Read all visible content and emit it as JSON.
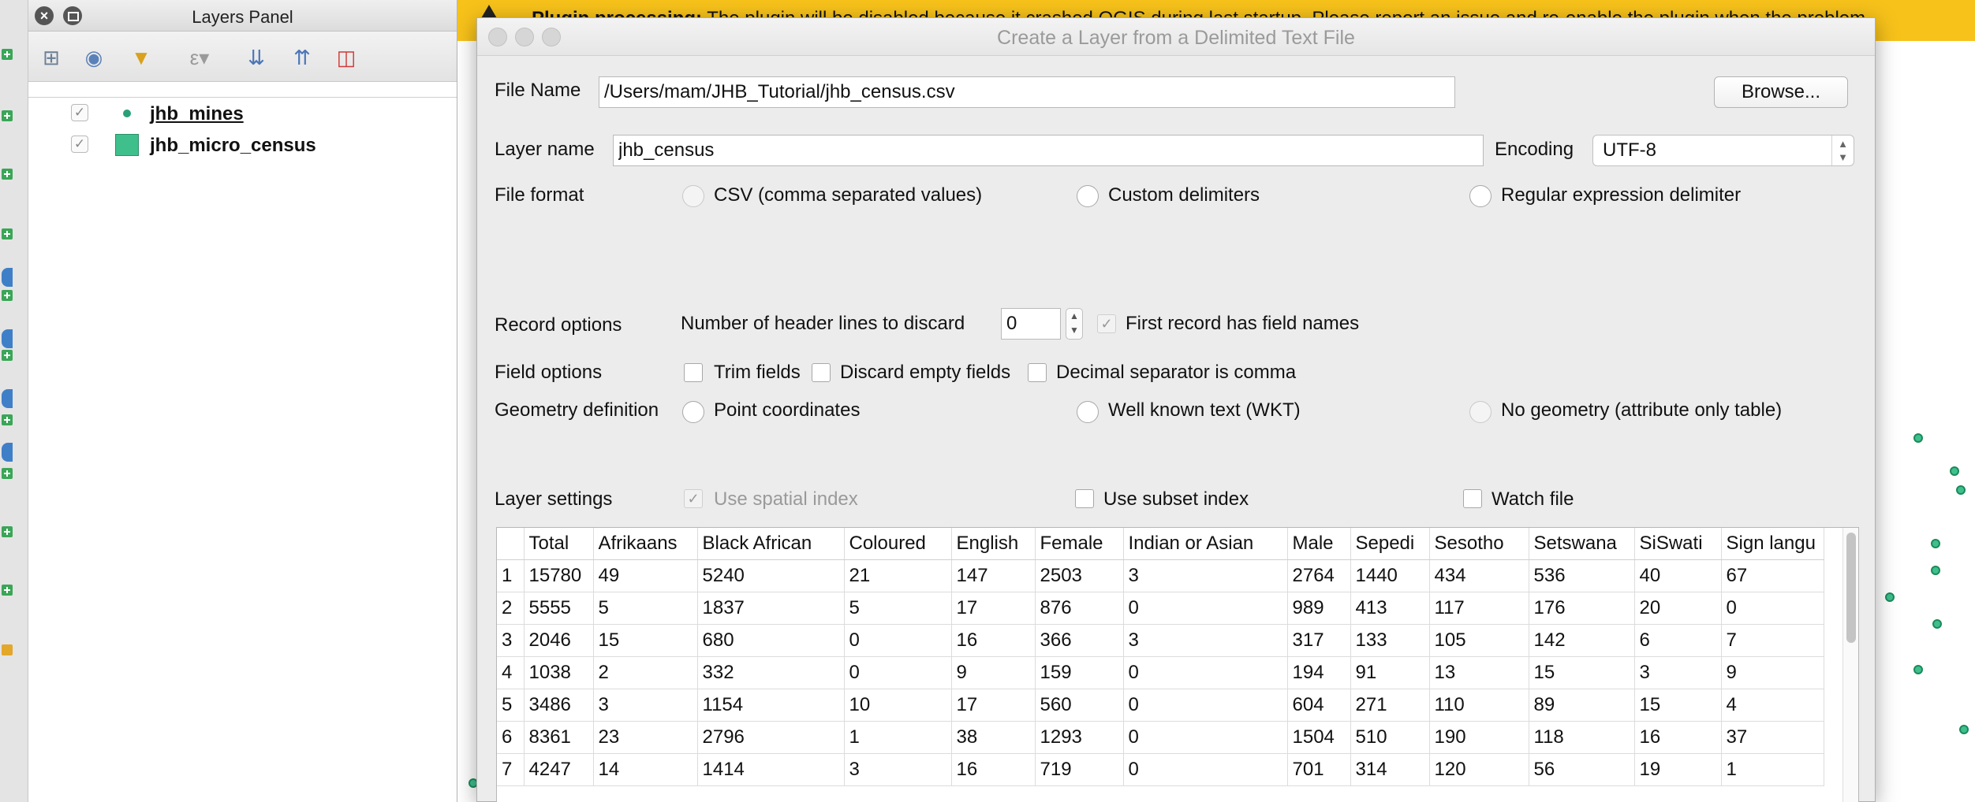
{
  "layers_panel": {
    "title": "Layers Panel",
    "layers": [
      {
        "name": "jhb_mines",
        "checked": true,
        "symbol": "point"
      },
      {
        "name": "jhb_micro_census",
        "checked": true,
        "symbol": "polygon"
      }
    ]
  },
  "banner": {
    "bold": "Plugin processing:",
    "text": " The plugin will be disabled because it crashed QGIS during last startup. Please report an issue and re-enable the plugin when the problem"
  },
  "dialog": {
    "title": "Create a Layer from a Delimited Text File",
    "file_name_label": "File Name",
    "file_name_value": "/Users/mam/JHB_Tutorial/jhb_census.csv",
    "browse_label": "Browse...",
    "layer_name_label": "Layer name",
    "layer_name_value": "jhb_census",
    "encoding_label": "Encoding",
    "encoding_value": "UTF-8",
    "file_format_label": "File format",
    "file_format_options": [
      "CSV (comma separated values)",
      "Custom delimiters",
      "Regular expression delimiter"
    ],
    "record_options_label": "Record options",
    "header_lines_label": "Number of header lines to discard",
    "header_lines_value": "0",
    "first_record_label": "First record has field names",
    "field_options_label": "Field options",
    "trim_fields_label": "Trim fields",
    "discard_empty_label": "Discard empty fields",
    "decimal_comma_label": "Decimal separator is comma",
    "geometry_label": "Geometry definition",
    "geometry_options": [
      "Point coordinates",
      "Well known text (WKT)",
      "No geometry (attribute only table)"
    ],
    "layer_settings_label": "Layer settings",
    "spatial_index_label": "Use spatial index",
    "subset_index_label": "Use subset index",
    "watch_file_label": "Watch file"
  },
  "table": {
    "columns": [
      "",
      "Total",
      "Afrikaans",
      "Black African",
      "Coloured",
      "English",
      "Female",
      "Indian or Asian",
      "Male",
      "Sepedi",
      "Sesotho",
      "Setswana",
      "SiSwati",
      "Sign langu"
    ],
    "rows": [
      [
        "1",
        "15780",
        "49",
        "5240",
        "21",
        "147",
        "2503",
        "3",
        "2764",
        "1440",
        "434",
        "536",
        "40",
        "67"
      ],
      [
        "2",
        "5555",
        "5",
        "1837",
        "5",
        "17",
        "876",
        "0",
        "989",
        "413",
        "117",
        "176",
        "20",
        "0"
      ],
      [
        "3",
        "2046",
        "15",
        "680",
        "0",
        "16",
        "366",
        "3",
        "317",
        "133",
        "105",
        "142",
        "6",
        "7"
      ],
      [
        "4",
        "1038",
        "2",
        "332",
        "0",
        "9",
        "159",
        "0",
        "194",
        "91",
        "13",
        "15",
        "3",
        "9"
      ],
      [
        "5",
        "3486",
        "3",
        "1154",
        "10",
        "17",
        "560",
        "0",
        "604",
        "271",
        "110",
        "89",
        "15",
        "4"
      ],
      [
        "6",
        "8361",
        "23",
        "2796",
        "1",
        "38",
        "1293",
        "0",
        "1504",
        "510",
        "190",
        "118",
        "16",
        "37"
      ],
      [
        "7",
        "4247",
        "14",
        "1414",
        "3",
        "16",
        "719",
        "0",
        "701",
        "314",
        "120",
        "56",
        "19",
        "1"
      ]
    ]
  }
}
